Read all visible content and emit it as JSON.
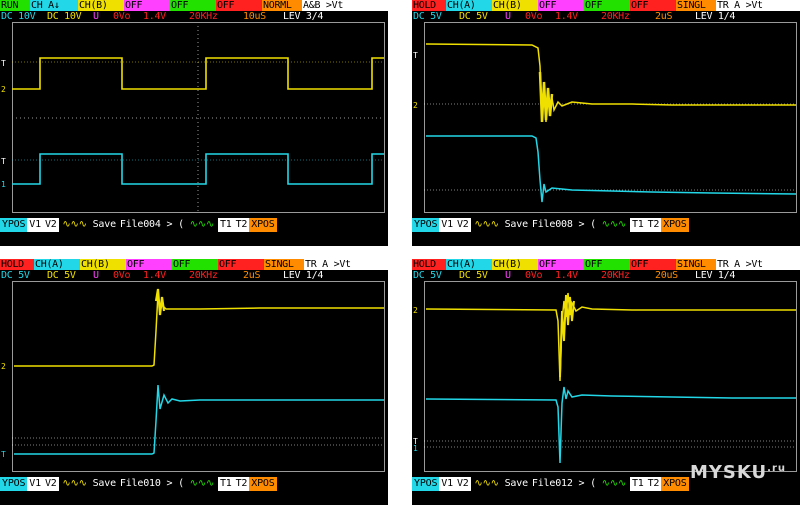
{
  "scopes": [
    {
      "row1": [
        "RUN",
        "CH A↓",
        "CH(B)",
        "OFF",
        "OFF",
        "OFF",
        "NORML",
        "A&B >Vt"
      ],
      "row2": [
        "DC 10V",
        "DC 10V",
        "U",
        "0Vo",
        "1.4V",
        "20KHz",
        "10uS",
        "LEV 3/4"
      ],
      "bottom": [
        "YPOS",
        "V1",
        "V2",
        "Save",
        "File004 > (",
        "T1",
        "T2",
        "XPOS"
      ]
    },
    {
      "row1": [
        "HOLD",
        "CH(A)",
        "CH(B)",
        "OFF",
        "OFF",
        "OFF",
        "SINGL",
        "TR A >Vt"
      ],
      "row2": [
        "DC 5V",
        "DC 5V",
        "U",
        "0Vo",
        "1.4V",
        "20KHz",
        "2uS",
        "LEV 1/4"
      ],
      "bottom": [
        "YPOS",
        "V1",
        "V2",
        "Save",
        "File008 > (",
        "T1",
        "T2",
        "XPOS"
      ]
    },
    {
      "row1": [
        "HOLD",
        "CH(A)",
        "CH(B)",
        "OFF",
        "OFF",
        "OFF",
        "SINGL",
        "TR A >Vt"
      ],
      "row2": [
        "DC 5V",
        "DC 5V",
        "U",
        "0Vo",
        "1.4V",
        "20KHz",
        "2uS",
        "LEV 1/4"
      ],
      "bottom": [
        "YPOS",
        "V1",
        "V2",
        "Save",
        "File010 > (",
        "T1",
        "T2",
        "XPOS"
      ]
    },
    {
      "row1": [
        "HOLD",
        "CH(A)",
        "CH(B)",
        "OFF",
        "OFF",
        "OFF",
        "SINGL",
        "TR A >Vt"
      ],
      "row2": [
        "DC 5V",
        "DC 5V",
        "U",
        "0Vo",
        "1.4V",
        "20KHz",
        "20uS",
        "LEV 1/4"
      ],
      "bottom": [
        "YPOS",
        "V1",
        "V2",
        "Save",
        "File012 > (",
        "T1",
        "T2",
        "XPOS"
      ]
    }
  ],
  "watermark": {
    "text": "MYSKU",
    "suffix": ".ru"
  },
  "colors": {
    "ch_a": "#f0e000",
    "ch_b": "#22d8e8",
    "grid": "#9a9a9a",
    "trigger": "#ffffff"
  },
  "icons": [
    "trigger-marker-icon",
    "channel-marker-icon"
  ]
}
